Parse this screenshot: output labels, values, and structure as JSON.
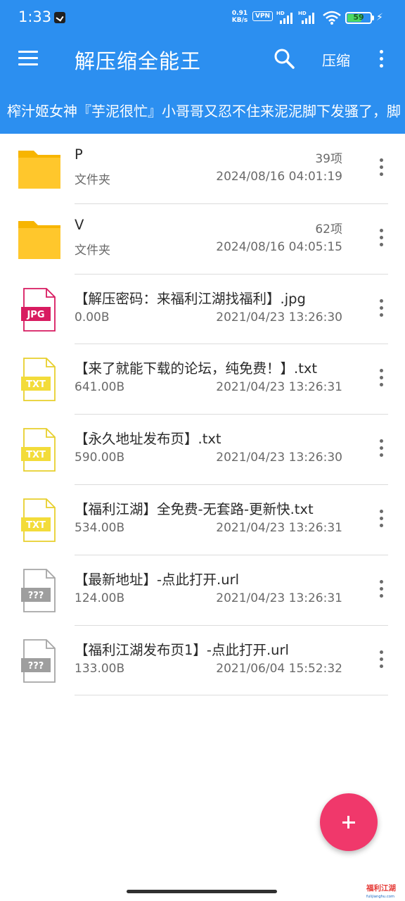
{
  "status_bar": {
    "time": "1:33",
    "speed_value": "0.91",
    "speed_unit": "KB/s",
    "vpn": "VPN",
    "battery": "59"
  },
  "appbar": {
    "title": "解压缩全能王",
    "compress_label": "压缩"
  },
  "ticker": {
    "text": "榨汁姬女神『芋泥很忙』小哥哥又忍不住来泥泥脚下发骚了，脚"
  },
  "files": [
    {
      "name": "P",
      "sub": "文件夹",
      "count": "39项",
      "date": "2024/08/16 04:01:19",
      "icon": "folder-icon"
    },
    {
      "name": "V",
      "sub": "文件夹",
      "count": "62项",
      "date": "2024/08/16 04:05:15",
      "icon": "folder-icon"
    },
    {
      "name": "【解压密码：来福利江湖找福利】.jpg",
      "sub": "0.00B",
      "count": "",
      "date": "2021/04/23 13:26:30",
      "icon": "jpg-file-icon",
      "badge": "JPG"
    },
    {
      "name": "【来了就能下载的论坛，纯免费！】.txt",
      "sub": "641.00B",
      "count": "",
      "date": "2021/04/23 13:26:31",
      "icon": "txt-file-icon",
      "badge": "TXT"
    },
    {
      "name": "【永久地址发布页】.txt",
      "sub": "590.00B",
      "count": "",
      "date": "2021/04/23 13:26:30",
      "icon": "txt-file-icon",
      "badge": "TXT"
    },
    {
      "name": "【福利江湖】全免费-无套路-更新快.txt",
      "sub": "534.00B",
      "count": "",
      "date": "2021/04/23 13:26:31",
      "icon": "txt-file-icon",
      "badge": "TXT"
    },
    {
      "name": "【最新地址】-点此打开.url",
      "sub": "124.00B",
      "count": "",
      "date": "2021/04/23 13:26:31",
      "icon": "unknown-file-icon",
      "badge": "???"
    },
    {
      "name": "【福利江湖发布页1】-点此打开.url",
      "sub": "133.00B",
      "count": "",
      "date": "2021/06/04 15:52:32",
      "icon": "unknown-file-icon",
      "badge": "???"
    }
  ],
  "watermark": {
    "brand": "福利江湖",
    "domain": "fulijianghu.com"
  },
  "colors": {
    "primary": "#2c8ff0",
    "fab": "#f0386b",
    "folder": "#ffc72c",
    "jpg": "#d81b60",
    "txt": "#f3dc3a",
    "unknown": "#9e9e9e"
  }
}
